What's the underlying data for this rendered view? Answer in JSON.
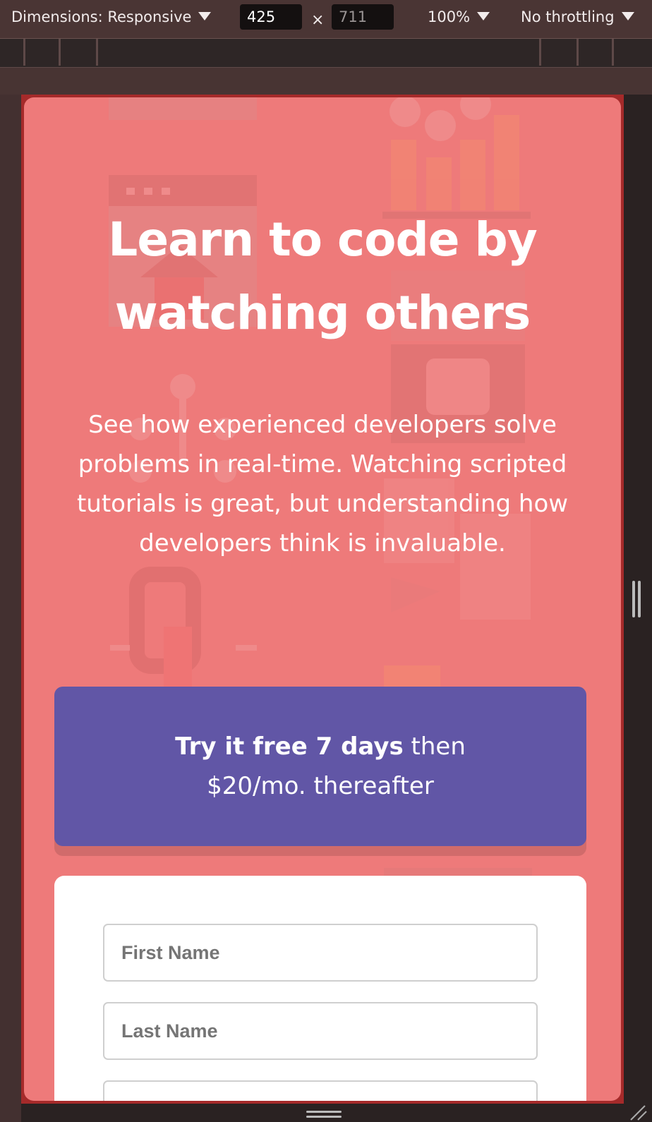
{
  "devtools": {
    "dimensions_label": "Dimensions: Responsive",
    "width_value": "425",
    "times_symbol": "×",
    "height_value": "711",
    "zoom": "100%",
    "throttling": "No throttling"
  },
  "hero": {
    "headline": "Learn to code by watching others",
    "intro": "See how experienced developers solve problems in real-time. Watching scripted tutorials is great, but understanding how developers think is invaluable."
  },
  "offer": {
    "bold": "Try it free 7 days",
    "rest": " then $20/mo. thereafter"
  },
  "form": {
    "first_name_placeholder": "First Name",
    "last_name_placeholder": "Last Name"
  },
  "colors": {
    "page_background": "#ee7a7a",
    "offer_background": "#6156a6",
    "form_background": "#ffffff"
  }
}
